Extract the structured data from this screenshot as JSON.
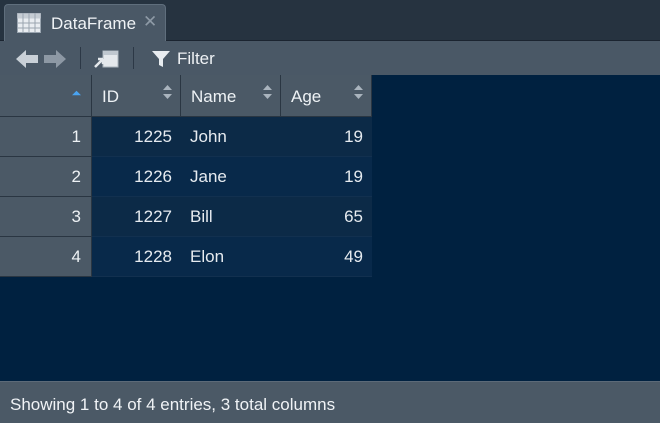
{
  "tab": {
    "title": "DataFrame",
    "close": "✕",
    "icon": "table-icon"
  },
  "toolbar": {
    "back_icon": "arrow-left-icon",
    "forward_icon": "arrow-right-icon",
    "popout_icon": "popout-window-icon",
    "filter_icon": "filter-icon",
    "filter_label": "Filter"
  },
  "table": {
    "columns": [
      "ID",
      "Name",
      "Age"
    ],
    "rows": [
      {
        "row": "1",
        "ID": "1225",
        "Name": "John",
        "Age": "19"
      },
      {
        "row": "2",
        "ID": "1226",
        "Name": "Jane",
        "Age": "19"
      },
      {
        "row": "3",
        "ID": "1227",
        "Name": "Bill",
        "Age": "65"
      },
      {
        "row": "4",
        "ID": "1228",
        "Name": "Elon",
        "Age": "49"
      }
    ]
  },
  "footer": {
    "status": "Showing 1 to 4 of 4 entries, 3 total columns"
  },
  "colors": {
    "grid_bg": "#002140",
    "header_bg": "#4b5966",
    "sort_active": "#4aa3f0"
  }
}
